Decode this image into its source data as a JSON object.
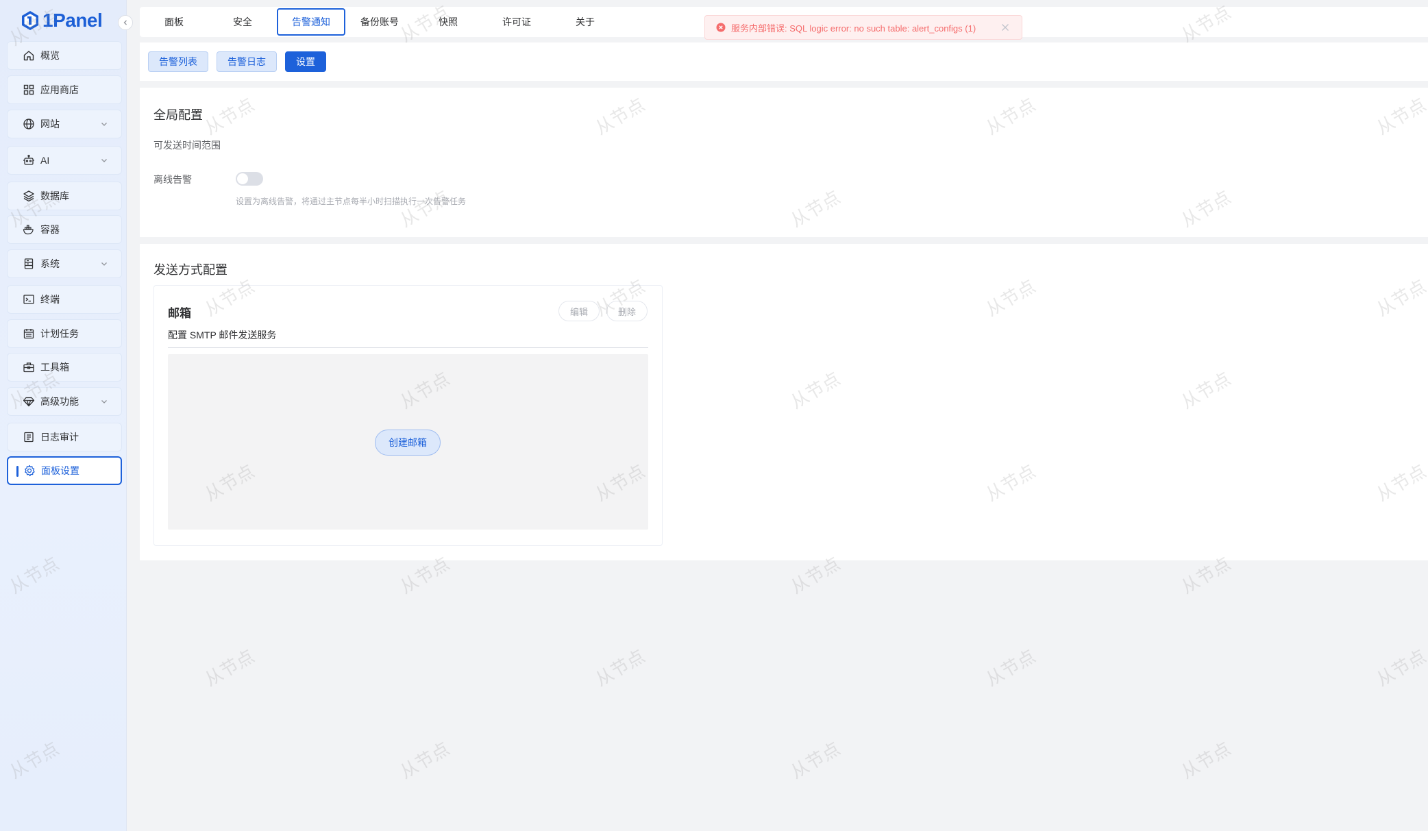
{
  "app": {
    "logo_text": "1Panel"
  },
  "sidebar": {
    "items": [
      {
        "label": "概览",
        "icon": "home-icon"
      },
      {
        "label": "应用商店",
        "icon": "grid-icon"
      },
      {
        "label": "网站",
        "icon": "globe-icon",
        "expandable": true
      },
      {
        "label": "AI",
        "icon": "robot-icon",
        "expandable": true
      },
      {
        "label": "数据库",
        "icon": "layers-icon"
      },
      {
        "label": "容器",
        "icon": "docker-icon"
      },
      {
        "label": "系统",
        "icon": "server-icon",
        "expandable": true
      },
      {
        "label": "终端",
        "icon": "terminal-icon"
      },
      {
        "label": "计划任务",
        "icon": "calendar-icon"
      },
      {
        "label": "工具箱",
        "icon": "toolbox-icon"
      },
      {
        "label": "高级功能",
        "icon": "diamond-icon",
        "expandable": true
      },
      {
        "label": "日志审计",
        "icon": "log-icon"
      },
      {
        "label": "面板设置",
        "icon": "gear-icon",
        "active": true
      }
    ]
  },
  "tabs": [
    "面板",
    "安全",
    "告警通知",
    "备份账号",
    "快照",
    "许可证",
    "关于"
  ],
  "active_tab": "告警通知",
  "toast": {
    "message": "服务内部错误: SQL logic error: no such table: alert_configs (1)"
  },
  "subtabs": {
    "alert_list": "告警列表",
    "alert_log": "告警日志",
    "settings": "设置"
  },
  "global_config": {
    "title": "全局配置",
    "send_time_label": "可发送时间范围",
    "offline_label": "离线告警",
    "offline_enabled": false,
    "offline_hint": "设置为离线告警，将通过主节点每半小时扫描执行一次告警任务"
  },
  "send_config": {
    "title": "发送方式配置",
    "email": {
      "title": "邮箱",
      "description": "配置 SMTP 邮件发送服务",
      "edit_label": "编辑",
      "delete_label": "删除",
      "create_label": "创建邮箱"
    }
  },
  "watermark_text": "从节点",
  "colors": {
    "accent": "#1d61da",
    "error": "#f56c6c",
    "background": "#f2f3f5"
  }
}
